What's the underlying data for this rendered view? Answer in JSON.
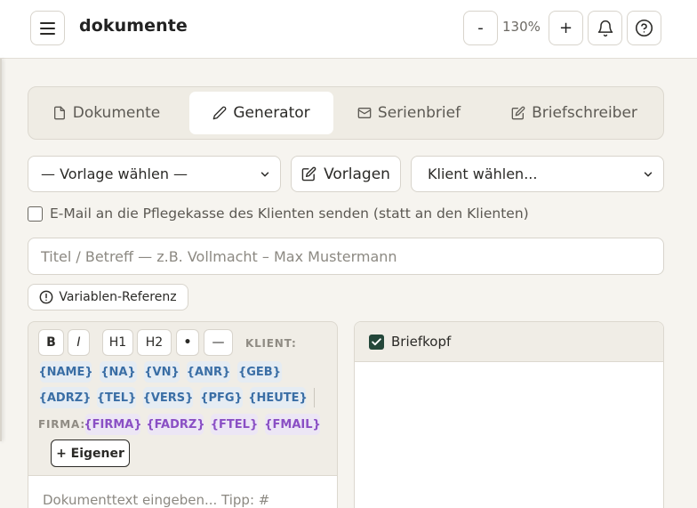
{
  "header": {
    "app_title": "dokumente",
    "zoom_minus": "-",
    "zoom_value": "130%",
    "zoom_plus": "+"
  },
  "tabs": [
    {
      "label": "Dokumente",
      "icon": "file-icon"
    },
    {
      "label": "Generator",
      "icon": "pencil-icon",
      "active": true
    },
    {
      "label": "Serienbrief",
      "icon": "mail-icon"
    },
    {
      "label": "Briefschreiber",
      "icon": "edit-square-icon"
    }
  ],
  "controls": {
    "template_select": "— Vorlage wählen —",
    "templates_button": "Vorlagen",
    "client_select": "Klient wählen..."
  },
  "email_option": {
    "label": "E-Mail an die Pflegekasse des Klienten senden (statt an den Klienten)",
    "checked": false
  },
  "title_field": {
    "placeholder": "Titel / Betreff — z.B. Vollmacht – Max Mustermann",
    "value": ""
  },
  "variables_button": "Variablen-Referenz",
  "editor": {
    "tools": [
      "B",
      "I",
      "H1",
      "H2",
      "•",
      "—"
    ],
    "client_label": "KLIENT:",
    "client_vars": [
      "{NAME}",
      "{NA}",
      "{VN}",
      "{ANR}",
      "{GEB}",
      "{ADRZ}",
      "{TEL}",
      "{VERS}",
      "{PFG}",
      "{HEUTE}"
    ],
    "company_label": "FIRMA:",
    "company_vars": [
      "{FIRMA}",
      "{FADRZ}",
      "{FTEL}",
      "{FMAIL}"
    ],
    "custom_button": "+ Eigener",
    "placeholder": "Dokumenttext eingeben... Tipp: #"
  },
  "preview": {
    "letterhead_label": "Briefkopf",
    "letterhead_checked": true
  },
  "colors": {
    "accent_dark": "#24473a",
    "chip_blue_text": "#3a6ea5",
    "chip_purple_text": "#8a4fc4",
    "background": "#f6f4ef"
  }
}
